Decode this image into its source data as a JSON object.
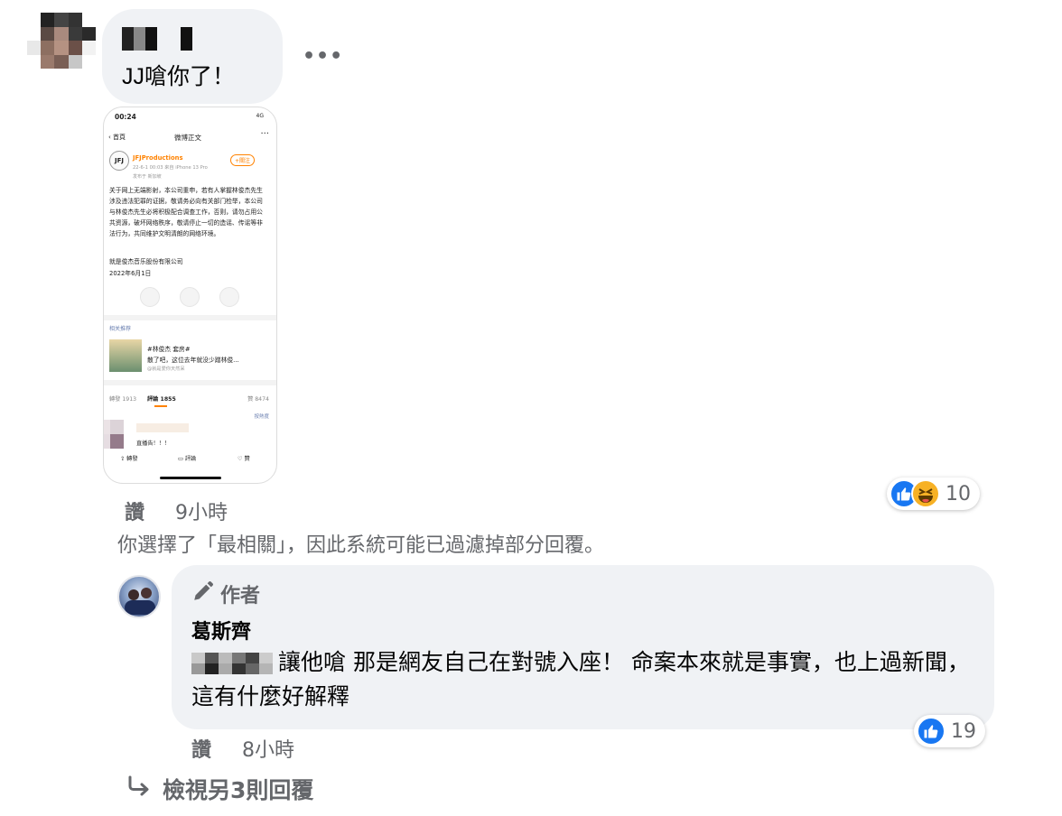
{
  "comment": {
    "text": "JJ嗆你了！",
    "more_label": "•••",
    "like_label": "讚",
    "time": "9小時",
    "reaction_count": "10"
  },
  "screenshot": {
    "status_time": "00:24",
    "status_signal": "4G",
    "back_label": "首頁",
    "title": "微博正文",
    "account": "JFJProductions",
    "post_meta": "22-6-1 00:03 來自 iPhone 13 Pro",
    "post_meta2": "发布于 新加坡",
    "follow_label": "+關注",
    "body": "关于网上无端影射，本公司重申，若有人掌握林俊杰先生涉及违法犯罪的证据，敬请务必向有关部门检举，本公司与林俊杰先生必将积极配合调查工作，否则，请勿占用公共资源，破坏网络秩序，敬请停止一切的造谣、传谣等非法行为，共同维护文明清朗的网络环境。",
    "sign": "就是俊杰音乐股份有限公司",
    "date": "2022年6月1日",
    "related_label": "相关推荐",
    "related_title": "#林俊杰 套房#",
    "related_text": "散了吧，这位去年就没少蹭林俊...",
    "related_source": "@就是爱你天然呆",
    "reposts": "轉發 1913",
    "comments": "評論 1855",
    "likes": "贊 8474",
    "sort_label": "按熱度",
    "reply_text": "直播告！！！",
    "btn_repost": "轉發",
    "btn_comment": "評論",
    "btn_like": "贊"
  },
  "notice": "你選擇了「最相關」，因此系統可能已過濾掉部分回覆。",
  "reply": {
    "author_badge": "作者",
    "name": "葛斯齊",
    "text": "讓他嗆 那是網友自己在對號入座！ 命案本來就是事實，也上過新聞，這有什麼好解釋",
    "like_label": "讚",
    "time": "8小時",
    "reaction_count": "19"
  },
  "view_more": "檢視另3則回覆",
  "colors": {
    "bubble": "#f0f2f5",
    "secondary_text": "#65676b",
    "like_blue": "#1877f2",
    "weibo_orange": "#ff8200"
  },
  "icons": [
    "like-icon",
    "haha-icon",
    "pencil-icon",
    "reply-arrow-icon",
    "more-icon"
  ]
}
